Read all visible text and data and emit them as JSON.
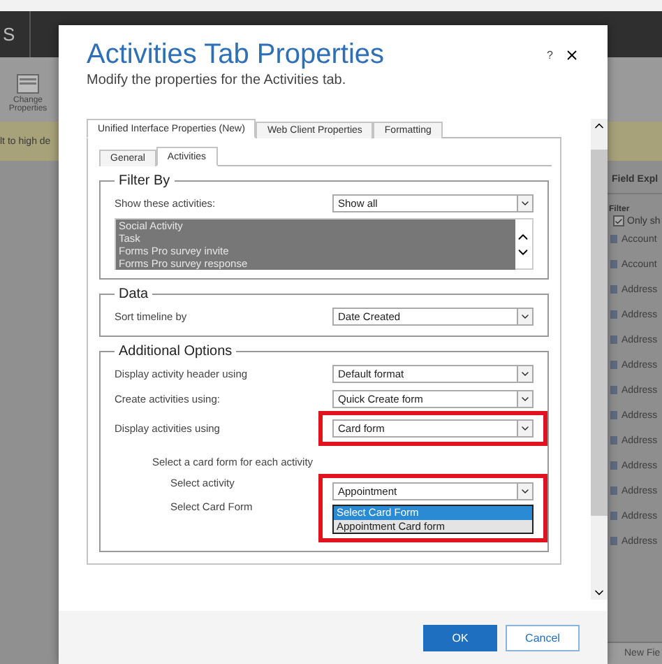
{
  "app_bar": {
    "label": "S"
  },
  "ribbon": {
    "buttons": [
      {
        "label": "Change Properties"
      }
    ]
  },
  "notification": {
    "text": "lt to high de"
  },
  "field_explorer": {
    "title": "Field Expl",
    "filter_label": "Filter",
    "only_show": {
      "label": "Only sh",
      "checked": true
    },
    "fields": [
      "Account",
      "Account",
      "Address",
      "Address",
      "Address",
      "Address",
      "Address",
      "Address",
      "Address",
      "Address",
      "Address",
      "Address",
      "Address"
    ],
    "new_button": "New Fie"
  },
  "dialog": {
    "title": "Activities Tab Properties",
    "subtitle": "Modify the properties for the Activities tab.",
    "help": "?",
    "tabs": [
      {
        "label": "Unified Interface Properties (New)",
        "selected": true
      },
      {
        "label": "Web Client Properties",
        "selected": false
      },
      {
        "label": "Formatting",
        "selected": false
      }
    ],
    "subtabs": [
      {
        "label": "General",
        "selected": false
      },
      {
        "label": "Activities",
        "selected": true
      }
    ],
    "filter": {
      "legend": "Filter By",
      "label": "Show these activities:",
      "value": "Show all",
      "activities": [
        {
          "label": "Social Activity",
          "selected": true
        },
        {
          "label": "Task",
          "selected": true
        },
        {
          "label": "Forms Pro survey invite",
          "selected": true
        },
        {
          "label": "Forms Pro survey response",
          "selected": true
        }
      ]
    },
    "data": {
      "legend": "Data",
      "label": "Sort timeline by",
      "value": "Date Created"
    },
    "options": {
      "legend": "Additional Options",
      "rows": [
        {
          "label": "Display activity header using",
          "value": "Default format",
          "highlighted": false
        },
        {
          "label": "Create activities using:",
          "value": "Quick Create form",
          "highlighted": false
        },
        {
          "label": "Display activities using",
          "value": "Card form",
          "highlighted": true
        }
      ],
      "card_intro": "Select a card form for each activity",
      "card_highlighted": true,
      "activity_label": "Select activity",
      "activity_value": "Appointment",
      "card_label": "Select Card Form",
      "card_options": [
        {
          "label": "Select Card Form",
          "selected": true
        },
        {
          "label": "Appointment Card form",
          "selected": false
        }
      ]
    },
    "buttons": [
      {
        "label": "OK",
        "kind": "primary"
      },
      {
        "label": "Cancel",
        "kind": "secondary"
      }
    ]
  }
}
